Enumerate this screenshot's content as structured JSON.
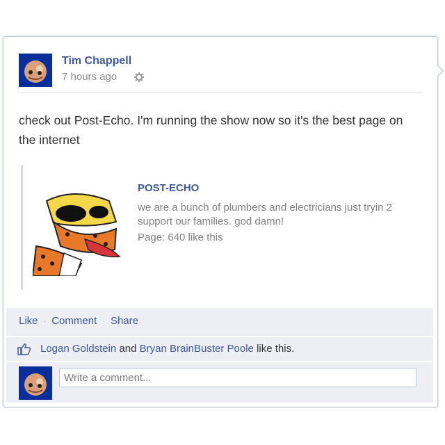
{
  "post": {
    "author": "Tim Chappell",
    "timestamp": "7 hours ago",
    "message": "check out Post-Echo. I'm running the show now so it's the best page on the internet"
  },
  "attachment": {
    "title": "POST-ECHO",
    "description": "we are a bunch of plumbers and electricians just tryin 2 support our families. god damn!",
    "meta": "Page: 640 like this"
  },
  "actions": {
    "like": "Like",
    "comment": "Comment",
    "share": "Share",
    "separator": "·"
  },
  "likes": {
    "user1": "Logan Goldstein",
    "connector": "and",
    "user2": "Bryan BrainBuster Poole",
    "suffix": "like this."
  },
  "comment_box": {
    "placeholder": "Write a comment..."
  },
  "colors": {
    "link": "#3b5998",
    "action_bg": "#edeff4"
  }
}
